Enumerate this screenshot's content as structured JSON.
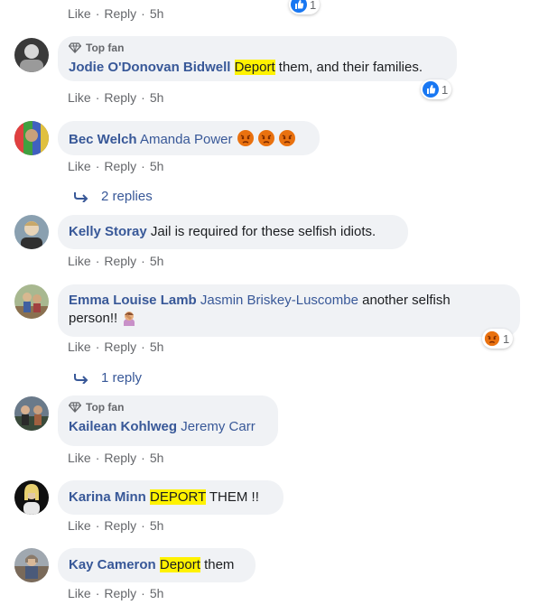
{
  "ui": {
    "like": "Like",
    "reply": "Reply",
    "sep": "·",
    "top_fan": "Top fan"
  },
  "top_partial": {
    "time": "5h",
    "reaction_count": "1"
  },
  "comments": [
    {
      "author": "Jodie O'Donovan Bidwell",
      "highlight": "Deport",
      "text": " them, and their families.",
      "time": "5h",
      "reaction_count": "1"
    },
    {
      "author": "Bec Welch",
      "mention": "Amanda Power",
      "time": "5h"
    },
    {
      "replies_label": "2 replies"
    },
    {
      "author": "Kelly Storay",
      "text": "Jail is required for these selfish idiots.",
      "time": "5h"
    },
    {
      "author": "Emma Louise Lamb",
      "mention": "Jasmin Briskey-Luscombe",
      "text": " another selfish",
      "text2": "person!!",
      "time": "5h",
      "reaction_count": "1"
    },
    {
      "replies_label": "1 reply"
    },
    {
      "author": "Kailean Kohlweg",
      "mention": "Jeremy Carr",
      "time": "5h"
    },
    {
      "author": "Karina Minn",
      "highlight": "DEPORT",
      "text": " THEM !!",
      "time": "5h"
    },
    {
      "author": "Kay Cameron",
      "highlight": "Deport",
      "text": " them",
      "time": "5h"
    }
  ],
  "colors": {
    "link": "#385898",
    "bubble": "#f0f2f5",
    "muted": "#65676b",
    "highlight": "#fff200",
    "like_blue": "#1877f2",
    "angry": "#e9710f"
  },
  "icons": {
    "top_fan": "diamond-badge-icon",
    "reply_arrow": "reply-arrow-icon",
    "like": "like-reaction-icon",
    "angry": "angry-emoji-icon",
    "facepalm": "facepalm-emoji-icon"
  }
}
